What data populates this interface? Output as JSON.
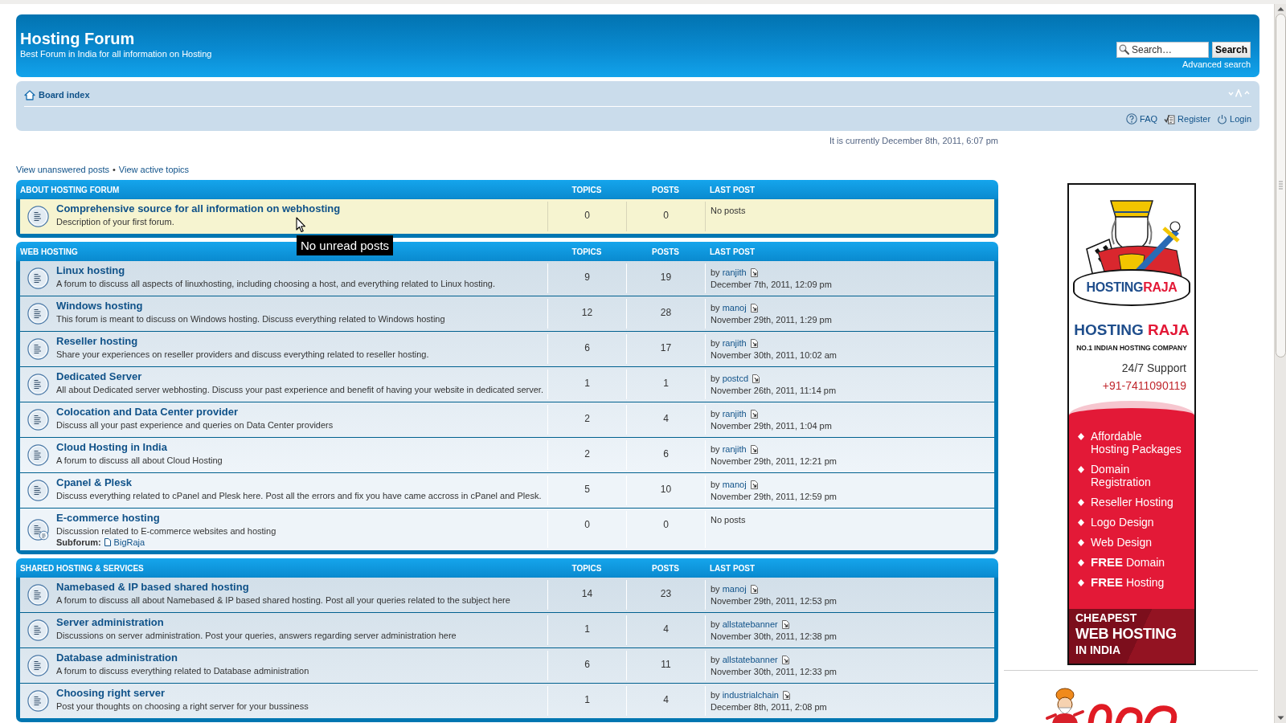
{
  "header": {
    "title": "Hosting Forum",
    "tagline": "Best Forum in India for all information on Hosting",
    "search": {
      "placeholder": "Search…",
      "button": "Search",
      "advanced_link": "Advanced search"
    }
  },
  "navbar": {
    "breadcrumb": "Board index",
    "links": [
      {
        "kind": "faq",
        "label": "FAQ"
      },
      {
        "kind": "register",
        "label": "Register"
      },
      {
        "kind": "login",
        "label": "Login"
      }
    ]
  },
  "current_time": "It is currently December 8th, 2011, 6:07 pm",
  "quick_links": {
    "items": [
      "View unanswered posts",
      "View active topics"
    ],
    "separator": "•"
  },
  "categories": [
    {
      "name": "ABOUT HOSTING FORUM",
      "columns": [
        "TOPICS",
        "POSTS",
        "LAST POST"
      ],
      "forums": [
        {
          "title": "Comprehensive source for all information on webhosting",
          "description": "Description of your first forum.",
          "topics": "0",
          "posts": "0",
          "hovered": true,
          "last_post": {
            "kind": "none",
            "text": "No posts"
          }
        }
      ]
    },
    {
      "name": "WEB HOSTING",
      "columns": [
        "TOPICS",
        "POSTS",
        "LAST POST"
      ],
      "forums": [
        {
          "title": "Linux hosting",
          "description": "A forum to discuss all aspects of linuxhosting, including choosing a host, and everything related to Linux hosting.",
          "topics": "9",
          "posts": "19",
          "hovered": false,
          "last_post": {
            "kind": "post",
            "by": "by",
            "author": "ranjith",
            "time": "December 7th, 2011, 12:09 pm"
          }
        },
        {
          "title": "Windows hosting",
          "description": "This forum is meant to discuss on Windows hosting. Discuss everything related to Windows hosting",
          "topics": "12",
          "posts": "28",
          "hovered": false,
          "last_post": {
            "kind": "post",
            "by": "by",
            "author": "manoj",
            "time": "November 29th, 2011, 1:29 pm"
          }
        },
        {
          "title": "Reseller hosting",
          "description": "Share your experiences on reseller providers and discuss everything related to reseller hosting.",
          "topics": "6",
          "posts": "17",
          "hovered": false,
          "last_post": {
            "kind": "post",
            "by": "by",
            "author": "ranjith",
            "time": "November 30th, 2011, 10:02 am"
          }
        },
        {
          "title": "Dedicated Server",
          "description": "All about Dedicated server webhosting. Discuss your past experience and benefit of having your website in dedicated server.",
          "topics": "1",
          "posts": "1",
          "hovered": false,
          "last_post": {
            "kind": "post",
            "by": "by",
            "author": "postcd",
            "time": "November 26th, 2011, 11:14 pm"
          }
        },
        {
          "title": "Colocation and Data Center provider",
          "description": "Discuss all your past experience and queries on Data Center providers",
          "topics": "2",
          "posts": "4",
          "hovered": false,
          "last_post": {
            "kind": "post",
            "by": "by",
            "author": "ranjith",
            "time": "November 29th, 2011, 1:04 pm"
          }
        },
        {
          "title": "Cloud Hosting in India",
          "description": "A forum to discuss all about Cloud Hosting",
          "topics": "2",
          "posts": "6",
          "hovered": false,
          "last_post": {
            "kind": "post",
            "by": "by",
            "author": "ranjith",
            "time": "November 29th, 2011, 12:21 pm"
          }
        },
        {
          "title": "Cpanel & Plesk",
          "description": "Discuss everything related to cPanel and Plesk here. Post all the errors and fix you have came accross in cPanel and Plesk.",
          "topics": "5",
          "posts": "10",
          "hovered": false,
          "last_post": {
            "kind": "post",
            "by": "by",
            "author": "manoj",
            "time": "November 29th, 2011, 12:59 pm"
          }
        },
        {
          "title": "E-commerce hosting",
          "description": "Discussion related to E-commerce websites and hosting",
          "topics": "0",
          "posts": "0",
          "hovered": false,
          "last_post": {
            "kind": "none",
            "text": "No posts"
          },
          "subforums": {
            "label": "Subforum:",
            "items": [
              "BigRaja"
            ]
          }
        }
      ]
    },
    {
      "name": "SHARED HOSTING & SERVICES",
      "columns": [
        "TOPICS",
        "POSTS",
        "LAST POST"
      ],
      "forums": [
        {
          "title": "Namebased & IP based shared hosting",
          "description": "A forum to discuss all about Namebased & IP based shared hosting. Post all your queries related to the subject here",
          "topics": "14",
          "posts": "23",
          "hovered": false,
          "last_post": {
            "kind": "post",
            "by": "by",
            "author": "manoj",
            "time": "November 29th, 2011, 12:53 pm"
          }
        },
        {
          "title": "Server administration",
          "description": "Discussions on server administration. Post your queries, answers regarding server administration here",
          "topics": "1",
          "posts": "4",
          "hovered": false,
          "last_post": {
            "kind": "post",
            "by": "by",
            "author": "allstatebanner",
            "time": "November 30th, 2011, 12:38 pm"
          }
        },
        {
          "title": "Database administration",
          "description": "A forum to discuss everything related to Database administration",
          "topics": "6",
          "posts": "11",
          "hovered": false,
          "last_post": {
            "kind": "post",
            "by": "by",
            "author": "allstatebanner",
            "time": "November 30th, 2011, 12:33 pm"
          }
        },
        {
          "title": "Choosing right server",
          "description": "Post your thoughts on choosing a right server for your bussiness",
          "topics": "1",
          "posts": "4",
          "hovered": false,
          "last_post": {
            "kind": "post",
            "by": "by",
            "author": "industrialchain",
            "time": "December 8th, 2011, 2:08 pm"
          }
        }
      ]
    }
  ],
  "tooltip": {
    "text": "No unread posts"
  },
  "ad": {
    "logo_ribbon": {
      "first": "HOSTING",
      "second": "RAJA"
    },
    "brand": {
      "first": "HOSTING",
      "second": "RAJA"
    },
    "slogan": "NO.1 INDIAN HOSTING COMPANY",
    "support": "24/7 Support",
    "phone": "+91-7411090119",
    "features": [
      "Affordable Hosting Packages",
      "Domain Registration",
      "Reseller Hosting",
      "Logo Design",
      "Web Design",
      "**FREE** Domain",
      "**FREE** Hosting"
    ],
    "footer": [
      "CHEAPEST",
      "WEB HOSTING",
      "IN INDIA"
    ]
  }
}
